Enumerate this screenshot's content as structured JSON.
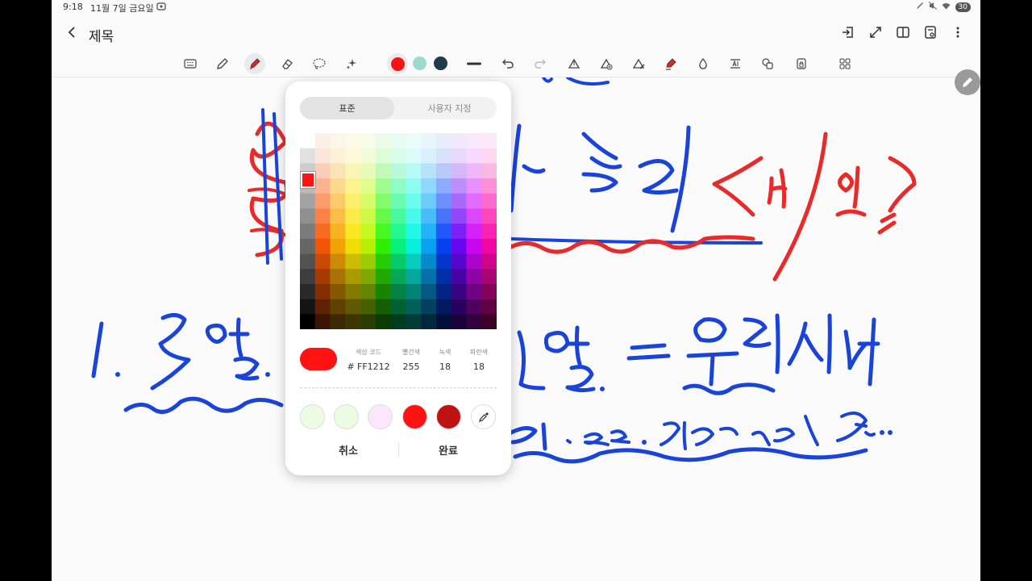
{
  "status": {
    "time": "9:18",
    "date": "11월 7일 금요일",
    "battery": "30"
  },
  "header": {
    "title": "제목",
    "icons": [
      "export-icon",
      "fullscreen-icon",
      "book-view-icon",
      "page-settings-icon",
      "more-icon"
    ]
  },
  "toolbar": {
    "tools": [
      "keyboard-icon",
      "pen-icon",
      "highlighter-icon",
      "eraser-icon",
      "lasso-icon",
      "ai-sparkle-icon"
    ],
    "colors": [
      "#ff1212",
      "#9fd8cf",
      "#1f3c48"
    ],
    "actions": [
      "stroke-width-icon",
      "undo-icon",
      "redo-icon",
      "shape-pen-icon",
      "shape-add-icon",
      "shape-edit-icon",
      "marker-icon",
      "fill-icon",
      "text-tool-icon",
      "shapes-icon",
      "lock-icon",
      "grid-icon"
    ]
  },
  "color_picker": {
    "tabs": {
      "standard": "표준",
      "custom": "사용자 지정"
    },
    "selected_color": "#ff1212",
    "labels": {
      "hex": "색상 코드",
      "red": "빨간색",
      "green": "녹색",
      "blue": "파란색"
    },
    "values": {
      "hex": "# FF1212",
      "red": "255",
      "green": "18",
      "blue": "18"
    },
    "recent_colors": [
      "#eefbe3",
      "#eefbe3",
      "#fbe6fb",
      "#ff1212",
      "#bf1212"
    ],
    "buttons": {
      "cancel": "취소",
      "done": "완료"
    }
  }
}
